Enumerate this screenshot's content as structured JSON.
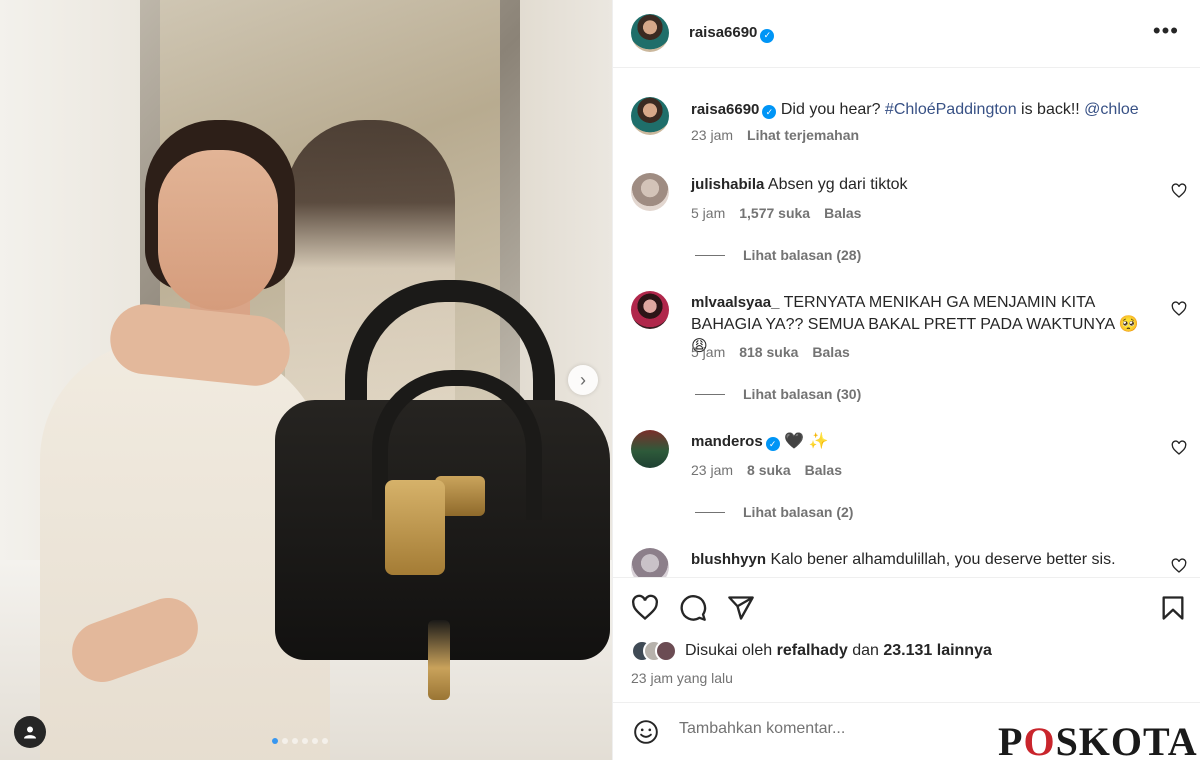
{
  "post": {
    "author": "raisa6690",
    "carousel": {
      "slide_count": 6,
      "active_slide": 1
    }
  },
  "caption": {
    "username": "raisa6690",
    "text_pre": "Did you hear? ",
    "hashtag": "#ChloéPaddington",
    "text_mid": " is back!! ",
    "mention": "@chloe",
    "time": "23 jam",
    "translate": "Lihat terjemahan"
  },
  "comments": [
    {
      "username": "julishabila",
      "text": "Absen yg dari tiktok",
      "time": "5 jam",
      "likes": "1,577 suka",
      "reply": "Balas",
      "view_replies": "Lihat balasan (28)"
    },
    {
      "username": "mlvaalsyaa_",
      "text": "TERNYATA MENIKAH GA MENJAMIN KITA BAHAGIA YA?? SEMUA BAKAL PRETT PADA WAKTUNYA 🥺 😩",
      "time": "5 jam",
      "likes": "818 suka",
      "reply": "Balas",
      "view_replies": "Lihat balasan (30)"
    },
    {
      "username": "manderos",
      "text": "🖤 ✨",
      "time": "23 jam",
      "likes": "8 suka",
      "reply": "Balas",
      "view_replies": "Lihat balasan (2)"
    },
    {
      "username": "blushhyyn",
      "text": "Kalo bener alhamdulillah, you deserve better sis."
    }
  ],
  "likes": {
    "prefix": "Disukai oleh",
    "liker": "refalhady",
    "joiner": "dan",
    "others": "23.131 lainnya"
  },
  "posted_ago": "23 jam yang lalu",
  "add_comment": {
    "placeholder": "Tambahkan komentar..."
  },
  "watermark": {
    "before": "P",
    "o": "O",
    "after": "SKOTA"
  },
  "colors": {
    "link": "#385185",
    "verified": "#0095f6",
    "muted": "#737373",
    "watermark_accent": "#c9252c"
  },
  "icons": [
    "more-icon",
    "verified-icon",
    "heart-icon",
    "comment-icon",
    "share-icon",
    "bookmark-icon",
    "emoji-icon",
    "chevron-right-icon",
    "user-tag-icon"
  ]
}
